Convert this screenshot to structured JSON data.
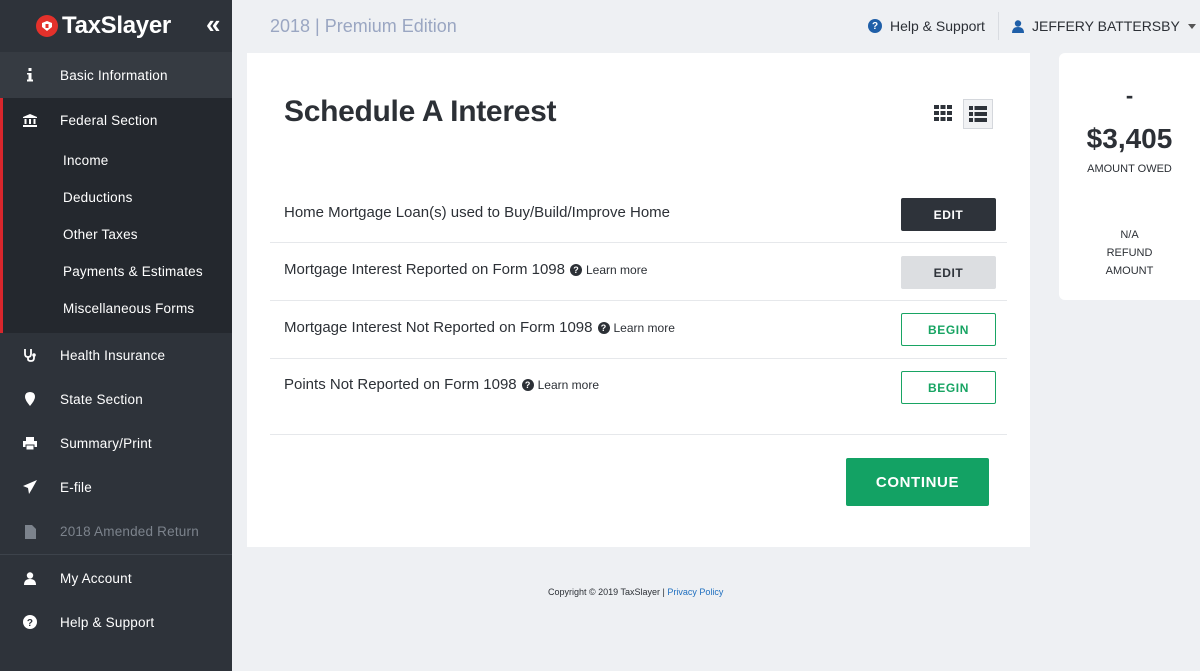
{
  "brand": {
    "name": "TaxSlayer",
    "collapse_glyph": "«",
    "logo_color": "#e4312b"
  },
  "header": {
    "edition": "2018 | Premium Edition",
    "help_label": "Help & Support",
    "user_name": "JEFFERY BATTERSBY"
  },
  "sidebar": {
    "basic": "Basic Information",
    "federal": "Federal Section",
    "federal_sub": [
      "Income",
      "Deductions",
      "Other Taxes",
      "Payments & Estimates",
      "Miscellaneous Forms"
    ],
    "health": "Health Insurance",
    "state": "State Section",
    "summary": "Summary/Print",
    "efile": "E-file",
    "amended": "2018 Amended Return",
    "account": "My Account",
    "help": "Help & Support"
  },
  "main": {
    "title": "Schedule A Interest",
    "rows": [
      {
        "label": "Home Mortgage Loan(s) used to Buy/Build/Improve Home",
        "learn": "",
        "button": "EDIT"
      },
      {
        "label": "Mortgage Interest Reported on Form 1098",
        "learn": "Learn more",
        "button": "EDIT"
      },
      {
        "label": "Mortgage Interest Not Reported on Form 1098",
        "learn": "Learn more",
        "button": "BEGIN"
      },
      {
        "label": "Points Not Reported on Form 1098",
        "learn": "Learn more",
        "button": "BEGIN"
      }
    ],
    "continue": "CONTINUE"
  },
  "summary": {
    "dash": "-",
    "amount": "$3,405",
    "amount_label": "AMOUNT OWED",
    "refund_value": "N/A",
    "refund_label_1": "REFUND",
    "refund_label_2": "AMOUNT"
  },
  "footer": {
    "copyright": "Copyright © 2019 TaxSlayer | ",
    "privacy": "Privacy Policy"
  },
  "colors": {
    "accent_green": "#13a264",
    "sidebar_bg": "#2e333a",
    "federal_marker": "#d8262c",
    "link_blue": "#1f6fbf"
  }
}
